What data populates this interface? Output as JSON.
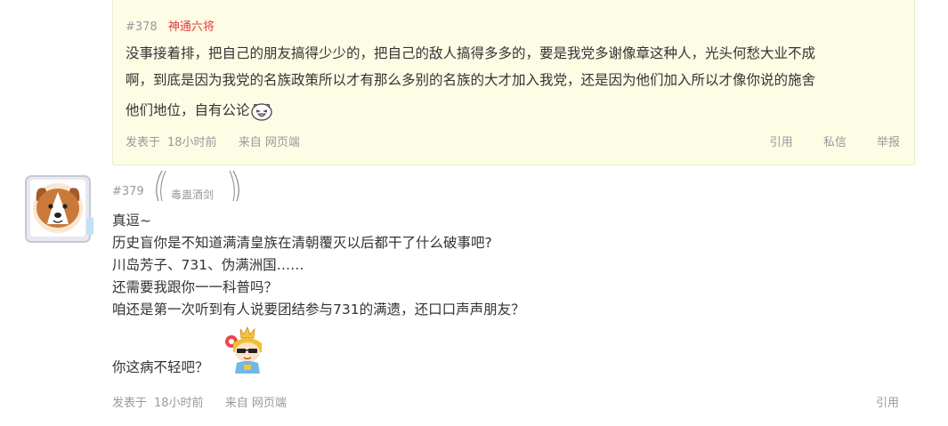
{
  "posts": [
    {
      "floor": "#378",
      "author": "神通六将",
      "lines": [
        "没事接着排，把自己的朋友搞得少少的，把自己的敌人搞得多多的，要是我党多谢像章这种人，光头何愁大业不成",
        "啊，到底是因为我党的名族政策所以才有那么多别的名族的大才加入我党，还是因为他们加入所以才像你说的施舍",
        "他们地位，自有公论"
      ],
      "emoji": "laughing-face-emoji",
      "footer": {
        "posted_label": "发表于",
        "time": "18小时前",
        "source": "来自 网页端"
      },
      "actions": [
        "引用",
        "私信",
        "举报"
      ]
    },
    {
      "floor": "#379",
      "author": "毒蛊酒剑",
      "avatar": "corgi-dog-avatar",
      "lines": [
        "真逗~",
        "历史盲你是不知道满清皇族在清朝覆灭以后都干了什么破事吧?",
        "川岛芳子、731、伪满洲国……",
        "还需要我跟你一一科普吗？",
        "咱还是第一次听到有人说要团结参与731的满遗，还口口声声朋友？",
        "",
        "你这病不轻吧？"
      ],
      "sticker": "cartoon-prince-sticker",
      "footer": {
        "posted_label": "发表于",
        "time": "18小时前",
        "source": "来自 网页端"
      },
      "actions": [
        "引用"
      ]
    }
  ],
  "colors": {
    "highlight_bg": "#fdfde6",
    "author_red": "#e4393c",
    "meta_gray": "#999999",
    "text": "#333333"
  }
}
